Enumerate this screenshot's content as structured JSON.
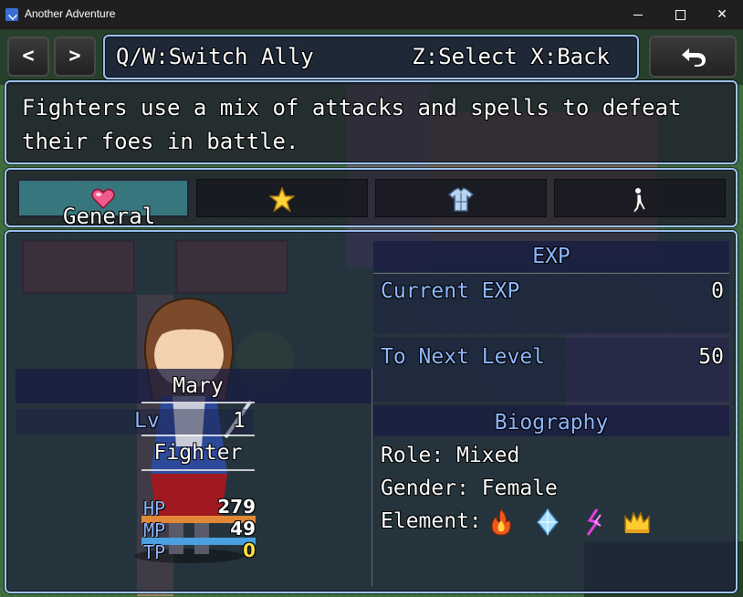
{
  "window": {
    "title": "Another Adventure"
  },
  "topbar": {
    "prev_label": "<",
    "next_label": ">",
    "help_left": "Q/W:Switch Ally",
    "help_right": "Z:Select X:Back"
  },
  "description": {
    "line1": "Fighters use a mix of attacks and spells to defeat",
    "line2": "their foes in battle."
  },
  "tabs": [
    {
      "label": "General",
      "icon": "heart-icon",
      "active": true
    },
    {
      "label": "",
      "icon": "star-icon",
      "active": false
    },
    {
      "label": "",
      "icon": "armor-icon",
      "active": false
    },
    {
      "label": "",
      "icon": "stance-icon",
      "active": false
    }
  ],
  "actor": {
    "name": "Mary",
    "level_label": "Lv",
    "level": "1",
    "class": "Fighter",
    "hp_label": "HP",
    "hp": "279",
    "hp_fraction": 1.0,
    "mp_label": "MP",
    "mp": "49",
    "mp_fraction": 1.0,
    "tp_label": "TP",
    "tp": "0",
    "tp_fraction": 0.0
  },
  "exp": {
    "header": "EXP",
    "current_label": "Current EXP",
    "current_value": "0",
    "next_label": "To Next Level",
    "next_value": "50"
  },
  "biography": {
    "header": "Biography",
    "role": "Role: Mixed",
    "gender": "Gender: Female",
    "element_label": "Element:",
    "elements": [
      "fire-icon",
      "ice-icon",
      "lightning-icon",
      "crown-icon"
    ]
  },
  "colors": {
    "frame": "#9ec3f0",
    "system_blue": "#8fb8ff",
    "hp_gauge": "#e08838",
    "mp_gauge": "#4aa0e0",
    "tp_value": "#ffe040",
    "active_tab": "#3c828c"
  }
}
